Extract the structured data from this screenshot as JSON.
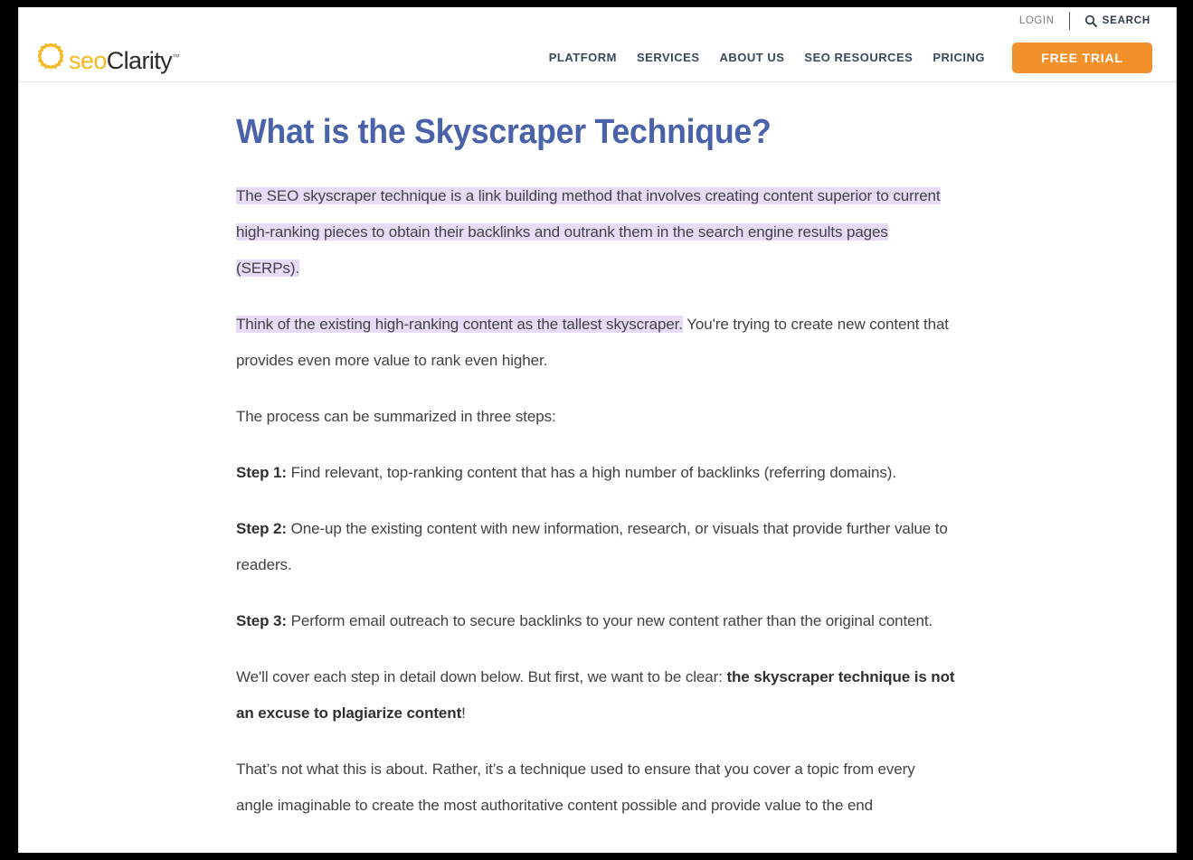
{
  "header": {
    "logo": {
      "mark_icon": "gear-sun-icon",
      "text_primary": "seo",
      "text_secondary": "Clarity",
      "trademark": "™",
      "color_primary": "#f5b820",
      "color_secondary": "#2b2b2b"
    },
    "utility": {
      "login_label": "LOGIN",
      "search_label": "SEARCH",
      "search_icon": "magnifier-icon"
    },
    "nav_items": [
      {
        "label": "PLATFORM"
      },
      {
        "label": "SERVICES"
      },
      {
        "label": "ABOUT US"
      },
      {
        "label": "SEO RESOURCES"
      },
      {
        "label": "PRICING"
      }
    ],
    "cta": {
      "label": "FREE TRIAL",
      "color": "#f3922b"
    },
    "nav_text_color": "#3a485c"
  },
  "article": {
    "title": "What is the Skyscraper Technique?",
    "title_color": "#4a62aa",
    "highlight_color": "#e8dbf7",
    "body_text_color": "#404244",
    "paragraphs": {
      "p1_highlight": "The SEO skyscraper technique is a link building method that involves creating content superior to current high-ranking pieces to obtain their backlinks and outrank them in the search engine results pages (SERPs).",
      "p2_highlight": "Think of the existing high-ranking content as the tallest skyscraper.",
      "p2_rest": " You're trying to create new content that provides even more value to rank even higher.",
      "p3": "The process can be summarized in three steps:",
      "step1_label": "Step 1:",
      "step1_text": " Find relevant, top-ranking content that has a high number of backlinks (referring domains).",
      "step2_label": "Step 2:",
      "step2_text": " One-up the existing content with new information, research, or visuals that provide further value to readers.",
      "step3_label": "Step 3:",
      "step3_text": " Perform email outreach to secure backlinks to your new content rather than the original content.",
      "p7_lead": "We'll cover each step in detail down below. But first, we want to be clear: ",
      "p7_bold": "the skyscraper technique is not an excuse to plagiarize content",
      "p7_tail": "!",
      "p8": "That’s not what this is about. Rather, it’s a technique used to ensure that you cover a topic from every angle imaginable to create the most authoritative content possible and provide value to the end"
    }
  }
}
